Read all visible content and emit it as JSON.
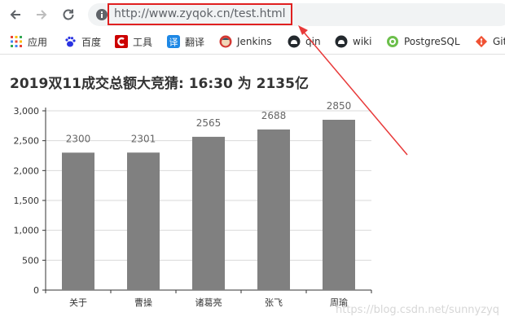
{
  "browser": {
    "url": "http://www.zyqok.cn/test.html",
    "highlight_color": "#e02020"
  },
  "bookmarks": [
    {
      "label": "应用",
      "icon": "apps-grid-icon"
    },
    {
      "label": "百度",
      "icon": "baidu-paw-icon"
    },
    {
      "label": "工具",
      "icon": "tools-icon"
    },
    {
      "label": "翻译",
      "icon": "translate-icon"
    },
    {
      "label": "Jenkins",
      "icon": "jenkins-icon"
    },
    {
      "label": "qin",
      "icon": "cat-icon"
    },
    {
      "label": "wiki",
      "icon": "cat-icon"
    },
    {
      "label": "PostgreSQL",
      "icon": "postgresql-icon"
    },
    {
      "label": "Git",
      "icon": "git-icon"
    }
  ],
  "page": {
    "title": "2019双11成交总额大竞猜: 16:30 为 2135亿"
  },
  "chart_data": {
    "type": "bar",
    "categories": [
      "关于",
      "曹操",
      "诸葛亮",
      "张飞",
      "周瑜"
    ],
    "values": [
      2300,
      2301,
      2565,
      2688,
      2850
    ],
    "data_labels": [
      "2300",
      "2301",
      "2565",
      "2688",
      "2850"
    ],
    "ylim": [
      0,
      3000
    ],
    "yticks": [
      "0",
      "500",
      "1,000",
      "1,500",
      "2,000",
      "2,500",
      "3,000"
    ],
    "grid": true,
    "bar_color": "#808080",
    "title": "",
    "xlabel": "",
    "ylabel": ""
  },
  "watermark": "https://blog.csdn.net/sunnyzyq"
}
